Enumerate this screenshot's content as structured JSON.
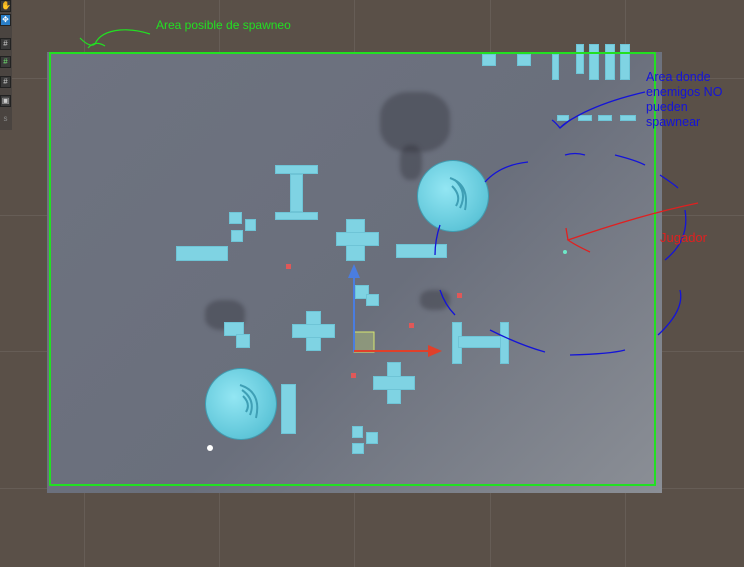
{
  "annotations": {
    "spawn_area": "Area posible de spawneo",
    "no_spawn_area": "Area donde\nenemigos NO\npueden\nspawnear",
    "player": "Jugador"
  },
  "colors": {
    "spawn_area": "#22e022",
    "no_spawn_area": "#1414d8",
    "player": "#e02020",
    "blocks": "#7fd3e3",
    "floor": "#6e7380",
    "background": "#5a5048"
  },
  "toolbar": {
    "items": [
      {
        "icon": "hand-tool-icon",
        "glyph": "✋"
      },
      {
        "icon": "move-tool-icon",
        "glyph": "✥"
      },
      {
        "icon": "grid-toggle-icon",
        "glyph": "#"
      },
      {
        "icon": "grid-snap-icon",
        "glyph": "#"
      },
      {
        "icon": "grid-settings-icon",
        "glyph": "#"
      },
      {
        "icon": "effects-toggle-icon",
        "glyph": "▣"
      },
      {
        "icon": "scale-label",
        "glyph": "s"
      }
    ]
  }
}
